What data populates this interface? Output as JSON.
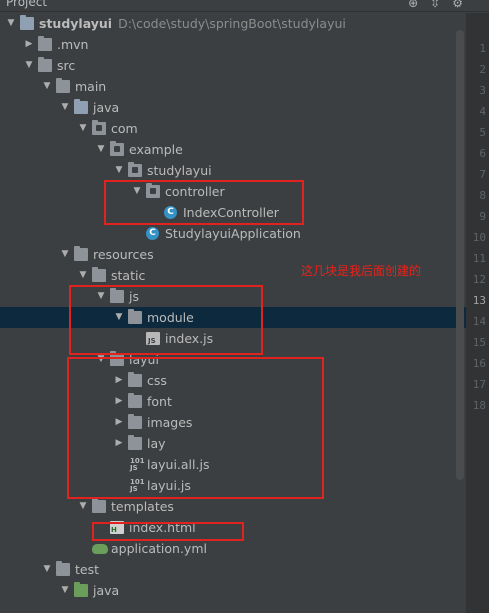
{
  "header": {
    "title": "Project"
  },
  "tree": [
    {
      "label": "studylayui",
      "path": "D:\\code\\study\\springBoot\\studylayui",
      "kind": "module",
      "expanded": true,
      "depth": 0
    },
    {
      "label": ".mvn",
      "kind": "folder",
      "expanded": false,
      "depth": 1
    },
    {
      "label": "src",
      "kind": "folder",
      "expanded": true,
      "depth": 1
    },
    {
      "label": "main",
      "kind": "folder",
      "expanded": true,
      "depth": 2
    },
    {
      "label": "java",
      "kind": "folder-src",
      "expanded": true,
      "depth": 3
    },
    {
      "label": "com",
      "kind": "package",
      "expanded": true,
      "depth": 4
    },
    {
      "label": "example",
      "kind": "package",
      "expanded": true,
      "depth": 5
    },
    {
      "label": "studylayui",
      "kind": "package",
      "expanded": true,
      "depth": 6
    },
    {
      "label": "controller",
      "kind": "package",
      "expanded": true,
      "depth": 7
    },
    {
      "label": "IndexController",
      "kind": "class",
      "depth": 8
    },
    {
      "label": "StudylayuiApplication",
      "kind": "app-class",
      "depth": 7
    },
    {
      "label": "resources",
      "kind": "folder-res",
      "expanded": true,
      "depth": 3
    },
    {
      "label": "static",
      "kind": "folder",
      "expanded": true,
      "depth": 4
    },
    {
      "label": "js",
      "kind": "folder",
      "expanded": true,
      "depth": 5
    },
    {
      "label": "module",
      "kind": "folder",
      "expanded": true,
      "depth": 6,
      "selected": true
    },
    {
      "label": "index.js",
      "kind": "js",
      "depth": 7
    },
    {
      "label": "layui",
      "kind": "folder",
      "expanded": true,
      "depth": 5
    },
    {
      "label": "css",
      "kind": "folder",
      "expanded": false,
      "depth": 6
    },
    {
      "label": "font",
      "kind": "folder",
      "expanded": false,
      "depth": 6
    },
    {
      "label": "images",
      "kind": "folder",
      "expanded": false,
      "depth": 6
    },
    {
      "label": "lay",
      "kind": "folder",
      "expanded": false,
      "depth": 6
    },
    {
      "label": "layui.all.js",
      "kind": "js-min",
      "depth": 6
    },
    {
      "label": "layui.js",
      "kind": "js-min",
      "depth": 6
    },
    {
      "label": "templates",
      "kind": "folder",
      "expanded": true,
      "depth": 4
    },
    {
      "label": "index.html",
      "kind": "html",
      "depth": 5
    },
    {
      "label": "application.yml",
      "kind": "yml",
      "depth": 4
    },
    {
      "label": "test",
      "kind": "folder",
      "expanded": true,
      "depth": 2
    },
    {
      "label": "java",
      "kind": "folder-test",
      "expanded": true,
      "depth": 3
    }
  ],
  "annotation": {
    "note": "这几块是我后面创建的",
    "color": "#e0231f"
  },
  "gutter": {
    "line_numbers": [
      "1",
      "2",
      "3",
      "4",
      "5",
      "6",
      "7",
      "8",
      "9",
      "10",
      "11",
      "12",
      "13",
      "14",
      "15",
      "16",
      "17",
      "18"
    ],
    "current_line": "13"
  },
  "colors": {
    "background": "#3c3f41",
    "selection": "#0d293e",
    "gutter": "#313335"
  }
}
